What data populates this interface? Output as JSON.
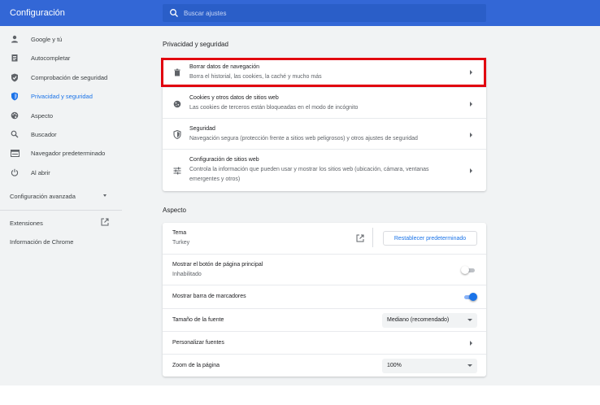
{
  "header": {
    "title": "Configuración",
    "search_placeholder": "Buscar ajustes"
  },
  "sidebar": {
    "items": [
      {
        "label": "Google y tú",
        "icon": "person-icon"
      },
      {
        "label": "Autocompletar",
        "icon": "clipboard-icon"
      },
      {
        "label": "Comprobación de seguridad",
        "icon": "shield-check-icon"
      },
      {
        "label": "Privacidad y seguridad",
        "icon": "shield-icon",
        "active": true
      },
      {
        "label": "Aspecto",
        "icon": "palette-icon"
      },
      {
        "label": "Buscador",
        "icon": "search-icon"
      },
      {
        "label": "Navegador predeterminado",
        "icon": "browser-icon"
      },
      {
        "label": "Al abrir",
        "icon": "power-icon"
      }
    ],
    "advanced": "Configuración avanzada",
    "extensions": "Extensiones",
    "about": "Información de Chrome"
  },
  "privacy": {
    "title": "Privacidad y seguridad",
    "rows": [
      {
        "title": "Borrar datos de navegación",
        "desc": "Borra el historial, las cookies, la caché y mucho más",
        "icon": "trash-icon"
      },
      {
        "title": "Cookies y otros datos de sitios web",
        "desc": "Las cookies de terceros están bloqueadas en el modo de incógnito",
        "icon": "cookie-icon"
      },
      {
        "title": "Seguridad",
        "desc": "Navegación segura (protección frente a sitios web peligrosos) y otros ajustes de seguridad",
        "icon": "shield-icon"
      },
      {
        "title": "Configuración de sitios web",
        "desc": "Controla la información que pueden usar y mostrar los sitios web (ubicación, cámara, ventanas",
        "desc2": "emergentes y otros)",
        "icon": "sliders-icon"
      }
    ]
  },
  "appearance": {
    "title": "Aspecto",
    "theme_label": "Tema",
    "theme_value": "Turkey",
    "reset_button": "Restablecer predeterminado",
    "home_button_label": "Mostrar el botón de página principal",
    "home_button_value": "Inhabilitado",
    "home_button_on": false,
    "bookmarks_label": "Mostrar barra de marcadores",
    "bookmarks_on": true,
    "font_size_label": "Tamaño de la fuente",
    "font_size_value": "Mediano (recomendado)",
    "custom_fonts_label": "Personalizar fuentes",
    "zoom_label": "Zoom de la página",
    "zoom_value": "100%"
  },
  "colors": {
    "header": "#3367d6",
    "accent": "#1a73e8",
    "highlight": "#e1000f"
  }
}
